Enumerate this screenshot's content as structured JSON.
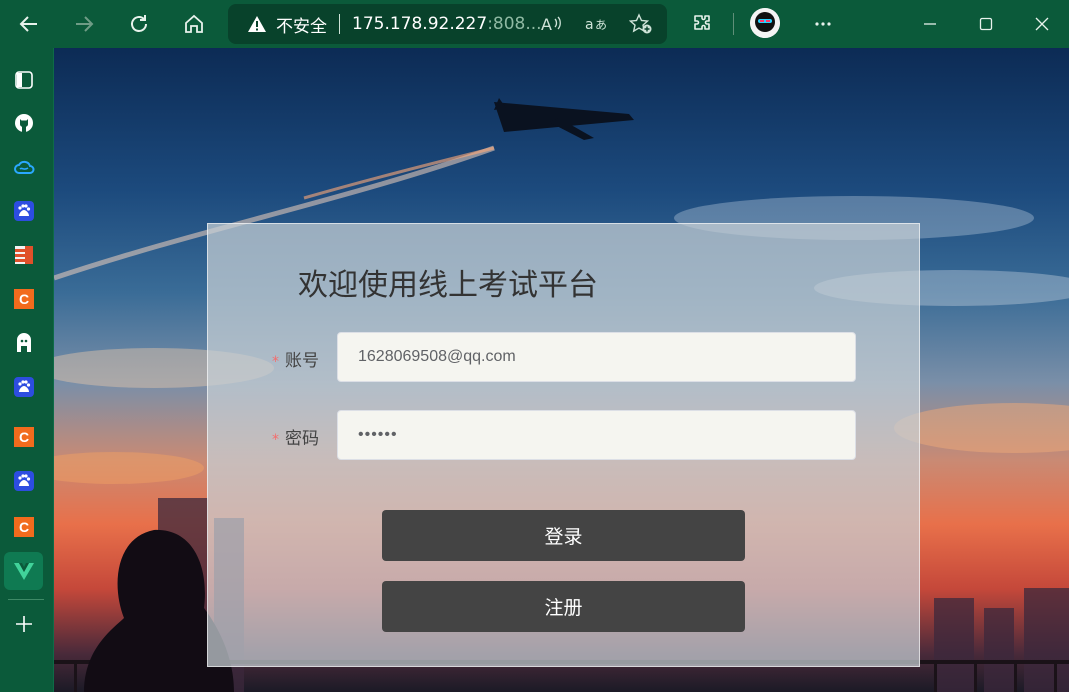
{
  "browser": {
    "security_label": "不安全",
    "url_host": "175.178.92.227",
    "url_port": ":808...",
    "icons": [
      "back-icon",
      "forward-icon",
      "refresh-icon",
      "home-icon",
      "warning-icon",
      "read-aloud-icon",
      "translate-icon",
      "favorite-add-icon",
      "extensions-icon",
      "profile-avatar",
      "more-icon",
      "minimize-icon",
      "maximize-icon",
      "close-icon"
    ],
    "accent": "#0b5a3a"
  },
  "sidebar": {
    "items": [
      {
        "name": "tab-actions-icon"
      },
      {
        "name": "github-icon"
      },
      {
        "name": "cloud-icon"
      },
      {
        "name": "baidu-icon"
      },
      {
        "name": "app-icon"
      },
      {
        "name": "csdn-icon"
      },
      {
        "name": "profile-app-icon"
      },
      {
        "name": "baidu-icon"
      },
      {
        "name": "csdn-icon"
      },
      {
        "name": "baidu-icon"
      },
      {
        "name": "csdn-icon"
      },
      {
        "name": "vue-icon"
      }
    ],
    "add_label": "+"
  },
  "login": {
    "title": "欢迎使用线上考试平台",
    "required_mark": "*",
    "account_label": "账号",
    "account_value": "1628069508@qq.com",
    "password_label": "密码",
    "password_value": "••••••",
    "login_button": "登录",
    "register_button": "注册"
  }
}
